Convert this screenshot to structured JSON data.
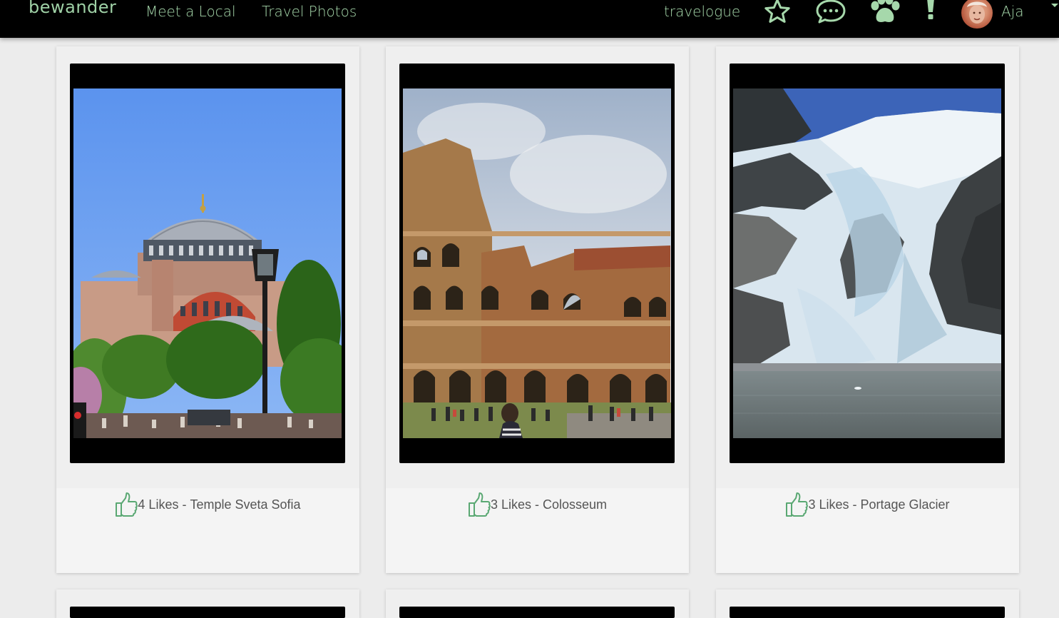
{
  "nav": {
    "brand": "bewander",
    "links": [
      "Meet a Local",
      "Travel Photos",
      "travelogue"
    ],
    "user_name": "Aja"
  },
  "icons": [
    "star-icon",
    "chat-bubble-icon",
    "paw-icon",
    "exclamation-icon",
    "user-avatar"
  ],
  "colors": {
    "nav_bg": "#000000",
    "accent": "#a6d8ab"
  },
  "photos": [
    {
      "likes": "4 Likes",
      "title": "Temple Sveta Sofia"
    },
    {
      "likes": "3 Likes",
      "title": "Colosseum"
    },
    {
      "likes": "3 Likes",
      "title": "Portage Glacier"
    }
  ],
  "separator": " - "
}
